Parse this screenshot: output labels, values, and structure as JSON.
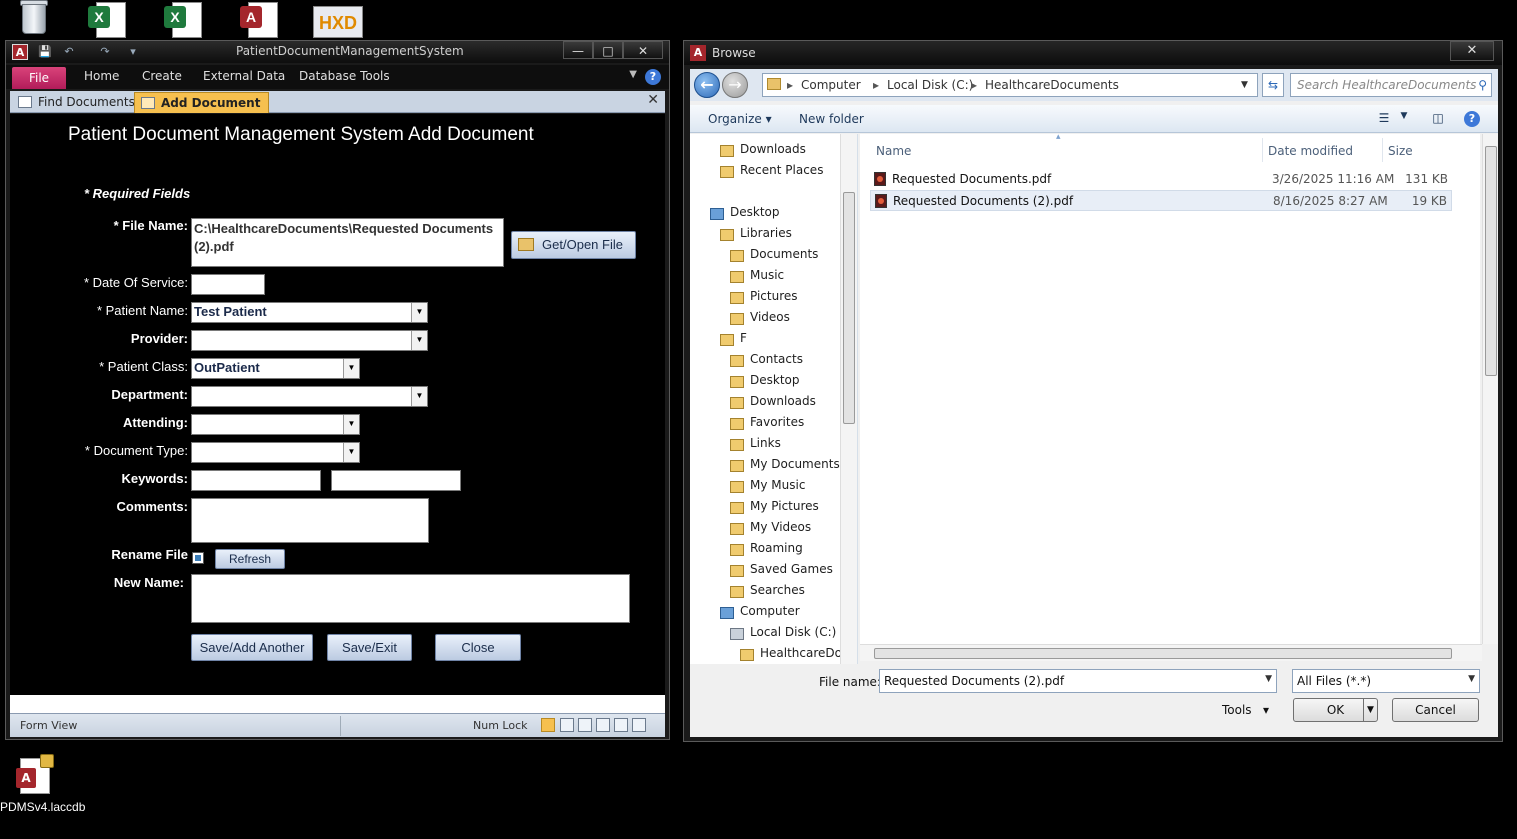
{
  "desktop": {
    "hxd_label": "HXD",
    "pdms_icon_label": "PDMSv4.laccdb"
  },
  "access": {
    "window_title": "PatientDocumentManagementSystem",
    "ribbon_tabs": [
      "File",
      "Home",
      "Create",
      "External Data",
      "Database Tools"
    ],
    "doc_tabs": [
      "Find Documents",
      "Add Document"
    ],
    "form": {
      "title": "Patient Document Management System Add Document",
      "required_note": "* Required Fields",
      "file_name_label": "* File Name:",
      "file_name_value": "C:\\HealthcareDocuments\\Requested Documents (2).pdf",
      "get_open_file_label": "Get/Open File",
      "date_of_service_label": "*  Date Of Service:",
      "date_of_service_value": "",
      "patient_name_label": "* Patient Name:",
      "patient_name_value": "Test Patient",
      "provider_label": "Provider:",
      "provider_value": "",
      "patient_class_label": "* Patient Class:",
      "patient_class_value": "OutPatient",
      "department_label": "Department:",
      "attending_label": "Attending:",
      "document_type_label": "* Document Type:",
      "keywords_label": "Keywords:",
      "comments_label": "Comments:",
      "rename_file_label": "Rename File",
      "refresh_label": "Refresh",
      "new_name_label": "New Name:",
      "save_add_label": "Save/Add Another",
      "save_exit_label": "Save/Exit",
      "close_label": "Close"
    },
    "status": {
      "left": "Form View",
      "right": "Num Lock"
    }
  },
  "browse": {
    "title": "Browse",
    "address": [
      "Computer",
      "Local Disk (C:)",
      "HealthcareDocuments"
    ],
    "search_placeholder": "Search HealthcareDocuments",
    "toolbar": {
      "organize": "Organize",
      "new_folder": "New folder"
    },
    "nav_items": [
      {
        "label": "Downloads",
        "indent": 1
      },
      {
        "label": "Recent Places",
        "indent": 1
      },
      {
        "label": "Desktop",
        "indent": 0
      },
      {
        "label": "Libraries",
        "indent": 1
      },
      {
        "label": "Documents",
        "indent": 2
      },
      {
        "label": "Music",
        "indent": 2
      },
      {
        "label": "Pictures",
        "indent": 2
      },
      {
        "label": "Videos",
        "indent": 2
      },
      {
        "label": "F",
        "indent": 1
      },
      {
        "label": "Contacts",
        "indent": 2
      },
      {
        "label": "Desktop",
        "indent": 2
      },
      {
        "label": "Downloads",
        "indent": 2
      },
      {
        "label": "Favorites",
        "indent": 2
      },
      {
        "label": "Links",
        "indent": 2
      },
      {
        "label": "My Documents",
        "indent": 2
      },
      {
        "label": "My Music",
        "indent": 2
      },
      {
        "label": "My Pictures",
        "indent": 2
      },
      {
        "label": "My Videos",
        "indent": 2
      },
      {
        "label": "Roaming",
        "indent": 2
      },
      {
        "label": "Saved Games",
        "indent": 2
      },
      {
        "label": "Searches",
        "indent": 2
      },
      {
        "label": "Computer",
        "indent": 1
      },
      {
        "label": "Local Disk (C:)",
        "indent": 2
      },
      {
        "label": "HealthcareDoc",
        "indent": 3
      }
    ],
    "columns": {
      "name": "Name",
      "date": "Date modified",
      "size": "Size"
    },
    "files": [
      {
        "name": "Requested Documents.pdf",
        "date": "3/26/2025 11:16 AM",
        "size": "131 KB"
      },
      {
        "name": "Requested Documents (2).pdf",
        "date": "8/16/2025 8:27 AM",
        "size": "19 KB"
      }
    ],
    "file_name_label": "File name:",
    "file_name_value": "Requested Documents (2).pdf",
    "filter_value": "All Files (*.*)",
    "tools_label": "Tools",
    "ok_label": "OK",
    "cancel_label": "Cancel"
  }
}
